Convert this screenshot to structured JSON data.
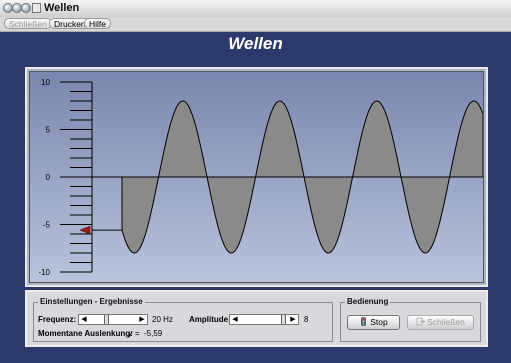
{
  "window": {
    "title": "Wellen"
  },
  "toolbar": {
    "buttons": [
      "Schließen",
      "Drucken",
      "Hilfe"
    ]
  },
  "header": {
    "title": "Wellen"
  },
  "chart_data": {
    "type": "line",
    "y_ticks": [
      "10",
      "5",
      "0",
      "-5",
      "-10"
    ],
    "ylim": [
      -10,
      10
    ],
    "amplitude": 8,
    "frequency_hz": 20,
    "current_displacement": -5.59,
    "wave_fill_color": "#8a8a8a",
    "background_top": "#7b86ae",
    "background_bottom": "#b9c3dc",
    "marker_color": "#a01818"
  },
  "settings": {
    "group_title": "Einstellungen - Ergebnisse",
    "frequency_label": "Frequenz:",
    "frequency_value": "20 Hz",
    "frequency_slider_fraction": 0.36,
    "amplitude_label": "Amplitude:",
    "amplitude_value": "8",
    "amplitude_slider_fraction": 0.96,
    "displacement_label": "Momentane Auslenkung:",
    "displacement_symbol": "y",
    "displacement_equals": "=",
    "displacement_value": "-5,59"
  },
  "operation": {
    "group_title": "Bedienung",
    "stop_label": "Stop",
    "close_label": "Schließen"
  }
}
